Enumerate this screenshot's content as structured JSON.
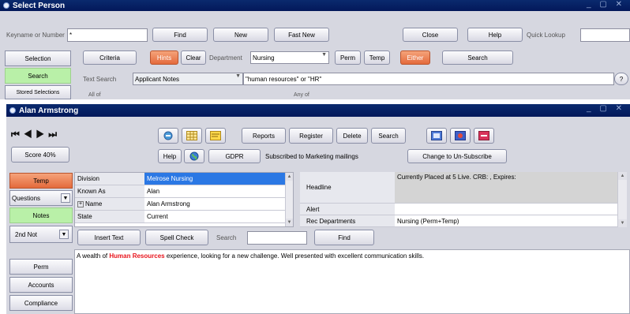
{
  "select_window": {
    "title": "Select Person",
    "keyname_label": "Keyname or Number",
    "keyname_value": "*",
    "find": "Find",
    "new": "New",
    "fast_new": "Fast New",
    "close": "Close",
    "help": "Help",
    "quick_lookup_label": "Quick Lookup",
    "quick_lookup_value": "",
    "side": {
      "selection": "Selection",
      "search": "Search",
      "stored": "Stored Selections"
    },
    "criteria": "Criteria",
    "hints": "Hints",
    "clear": "Clear",
    "department_label": "Department",
    "department_value": "Nursing",
    "perm": "Perm",
    "temp": "Temp",
    "either": "Either",
    "search_btn": "Search",
    "text_search_label": "Text Search",
    "text_search_type": "Applicant Notes",
    "text_search_value": "\"human resources\" or \"HR\"",
    "all_of": "All of",
    "any_of": "Any of"
  },
  "person_window": {
    "title": "Alan Armstrong",
    "score": "Score 40%",
    "reports": "Reports",
    "register": "Register",
    "delete": "Delete",
    "search": "Search",
    "help": "Help",
    "gdpr": "GDPR",
    "subscribed_text": "Subscribed to Marketing mailings",
    "unsubscribe": "Change to Un-Subscribe",
    "side": {
      "temp": "Temp",
      "questions": "Questions",
      "notes": "Notes",
      "second_notes": "2nd Not",
      "perm": "Perm",
      "accounts": "Accounts",
      "compliance": "Compliance"
    },
    "fields": [
      {
        "label": "Division",
        "value": "Melrose Nursing"
      },
      {
        "label": "Known As",
        "value": "Alan"
      },
      {
        "label": "Name",
        "value": "Alan Armstrong"
      },
      {
        "label": "State",
        "value": "Current"
      }
    ],
    "headline_label": "Headline",
    "headline_value": "Currently Placed at 5 Live.   CRB: , Expires:",
    "alert_label": "Alert",
    "rec_dept_label": "Rec Departments",
    "rec_dept_value": "Nursing (Perm+Temp)",
    "insert_text": "Insert Text",
    "spell_check": "Spell Check",
    "search_label": "Search",
    "search_value": "",
    "find": "Find",
    "notes_prefix": "A wealth of ",
    "notes_highlight": "Human Resources",
    "notes_suffix": " experience, looking for a new challenge.  Well presented with excellent communication skills.",
    "highlight_color": "#e8141c"
  }
}
